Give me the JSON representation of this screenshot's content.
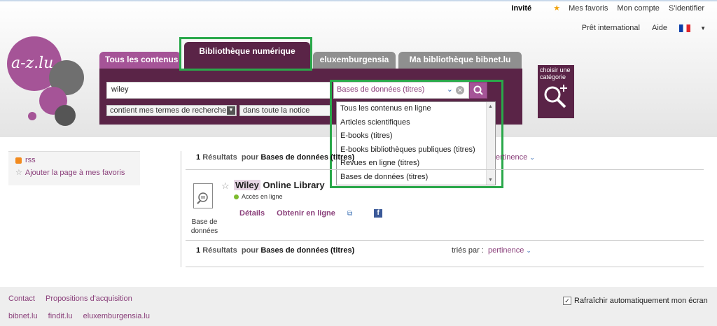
{
  "top_links": {
    "guest": "Invité",
    "favorites": "Mes favoris",
    "account": "Mon compte",
    "login": "S'identifier"
  },
  "sub_links": {
    "loan": "Prêt international",
    "help": "Aide"
  },
  "logo": {
    "text": "a-z.lu"
  },
  "tabs": [
    {
      "label": "Tous les contenus"
    },
    {
      "label": "Bibliothèque numérique"
    },
    {
      "label": "eluxemburgensia"
    },
    {
      "label": "Ma bibliothèque bibnet.lu"
    }
  ],
  "search": {
    "query": "wiley",
    "scope_selected": "Bases de données (titres)",
    "match_mode": "contient mes termes de recherche",
    "field": "dans toute la notice"
  },
  "scope_options": [
    "Tous les contenus en ligne",
    "Articles scientifiques",
    "E-books (titres)",
    "E-books bibliothèques publiques (titres)",
    "Revues en ligne (titres)",
    "Bases de données (titres)"
  ],
  "category_box": {
    "line1": "choisir une",
    "line2": "catégorie"
  },
  "sidebar": {
    "rss": "rss",
    "add_fav": "Ajouter la page à mes favoris"
  },
  "results": {
    "count": "1",
    "label": "Résultats",
    "pour": "pour",
    "scope": "Bases de données (titres)",
    "sort_label": "triés par :",
    "sort_value": "pertinence",
    "sort_value_partial": "ertinence"
  },
  "record": {
    "title_hit": "Wiley",
    "title_rest": "Online Library",
    "access": "Accès en ligne",
    "type_line1": "Base de",
    "type_line2": "données",
    "details": "Détails",
    "online": "Obtenir en ligne",
    "fb": "f"
  },
  "footer": {
    "contact": "Contact",
    "proposals": "Propositions d'acquisition",
    "links": [
      "bibnet.lu",
      "findit.lu",
      "eluxemburgensia.lu"
    ],
    "refresh": "Rafraîchir automatiquement mon écran"
  }
}
